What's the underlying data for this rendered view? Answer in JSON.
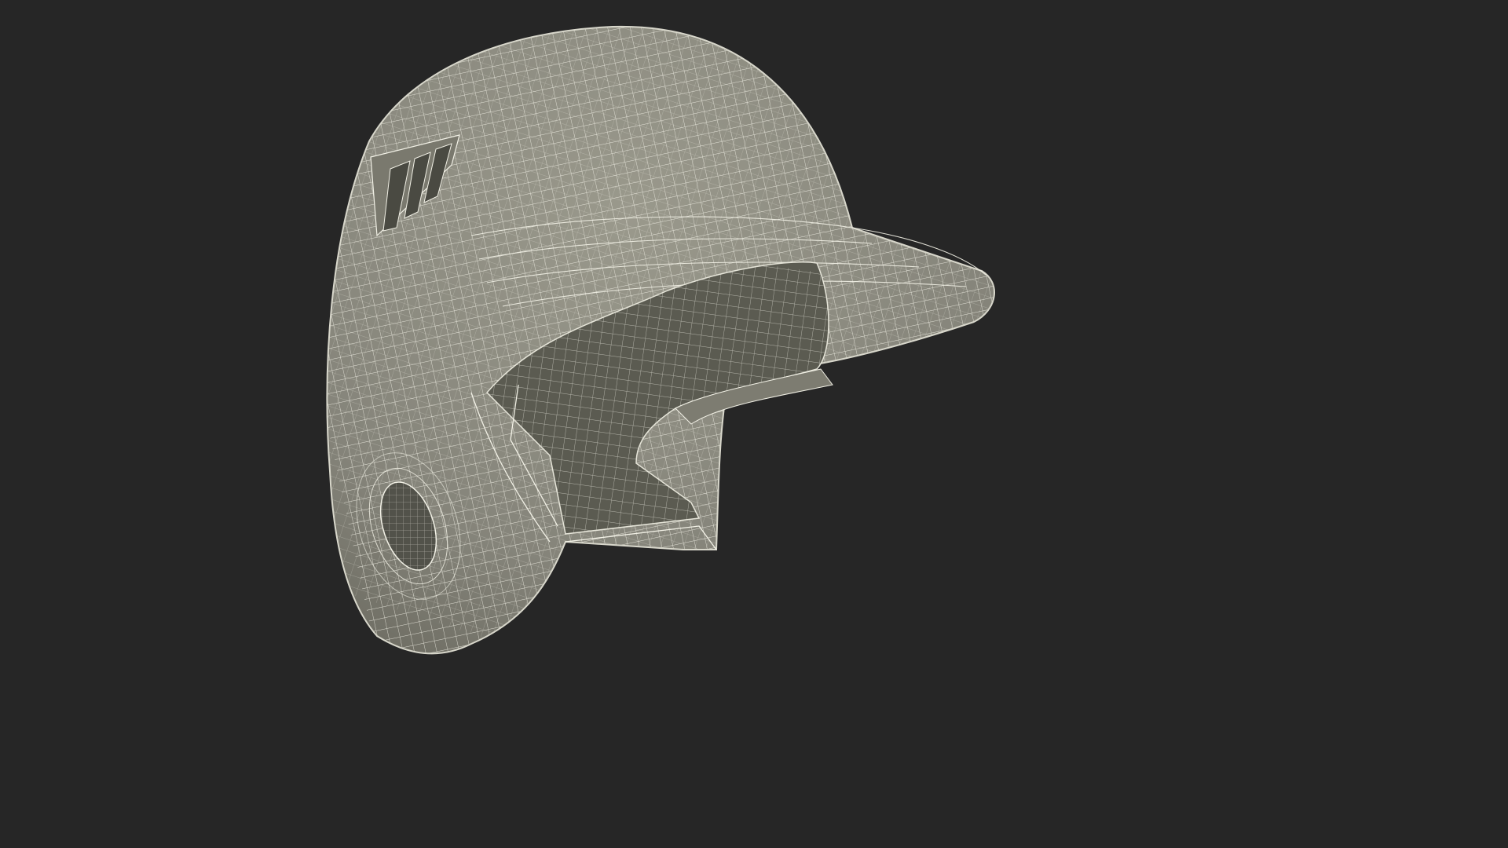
{
  "scene": {
    "subject": "baseball-batting-helmet-wireframe",
    "colors": {
      "background": "#262626",
      "shell": "#8c8b7e",
      "shell_shadow": "#6f6e63",
      "interior": "#5a5a50",
      "wire": "#f2f1e6",
      "vent": "#4a4a42"
    }
  }
}
